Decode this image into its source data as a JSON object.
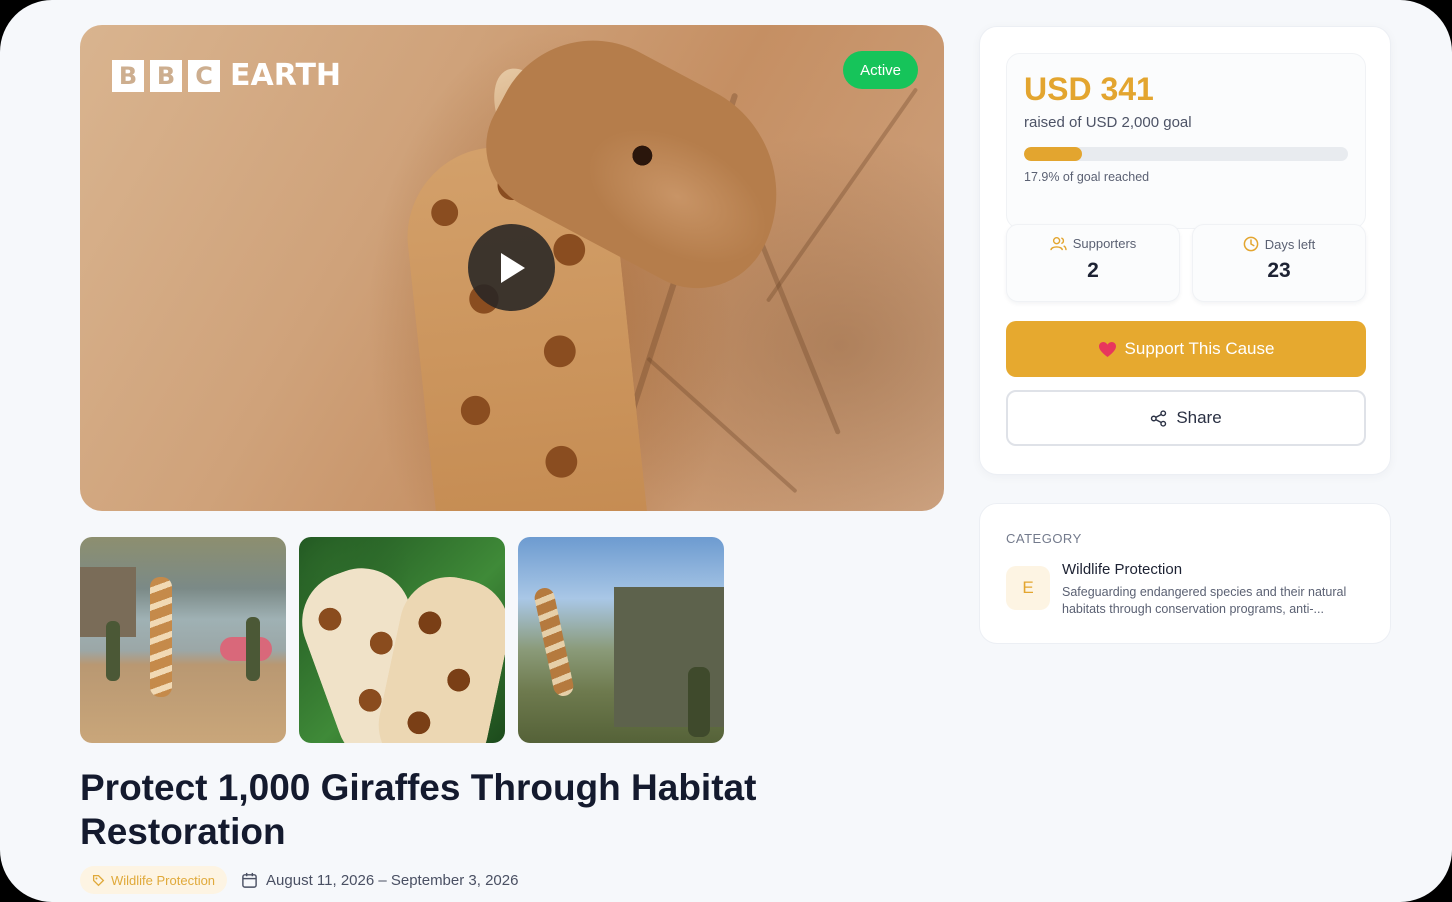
{
  "hero": {
    "logo_boxes": [
      "B",
      "B",
      "C"
    ],
    "logo_word": "EARTH",
    "status_badge": "Active"
  },
  "gallery": {
    "thumbnails": [
      "giraffe-by-water",
      "two-giraffes-nuzzling",
      "giraffe-loaded-in-truck"
    ]
  },
  "campaign": {
    "title": "Protect 1,000 Giraffes Through Habitat Restoration",
    "tag": "Wildlife Protection",
    "date_range": "August 11, 2026 – September 3, 2026"
  },
  "funding": {
    "amount": "USD 341",
    "goal_text": "raised of USD 2,000 goal",
    "progress_percent": 17.9,
    "progress_label": "17.9% of goal reached"
  },
  "stats": {
    "supporters_label": "Supporters",
    "supporters_value": "2",
    "days_left_label": "Days left",
    "days_left_value": "23"
  },
  "actions": {
    "support_label": "Support This Cause",
    "share_label": "Share"
  },
  "category": {
    "heading": "CATEGORY",
    "avatar_letter": "E",
    "name": "Wildlife Protection",
    "description": "Safeguarding endangered species and their natural habitats through conservation programs, anti-..."
  },
  "colors": {
    "accent": "#e6a92f",
    "active_badge": "#16c45a",
    "background": "#f6f8fb"
  }
}
